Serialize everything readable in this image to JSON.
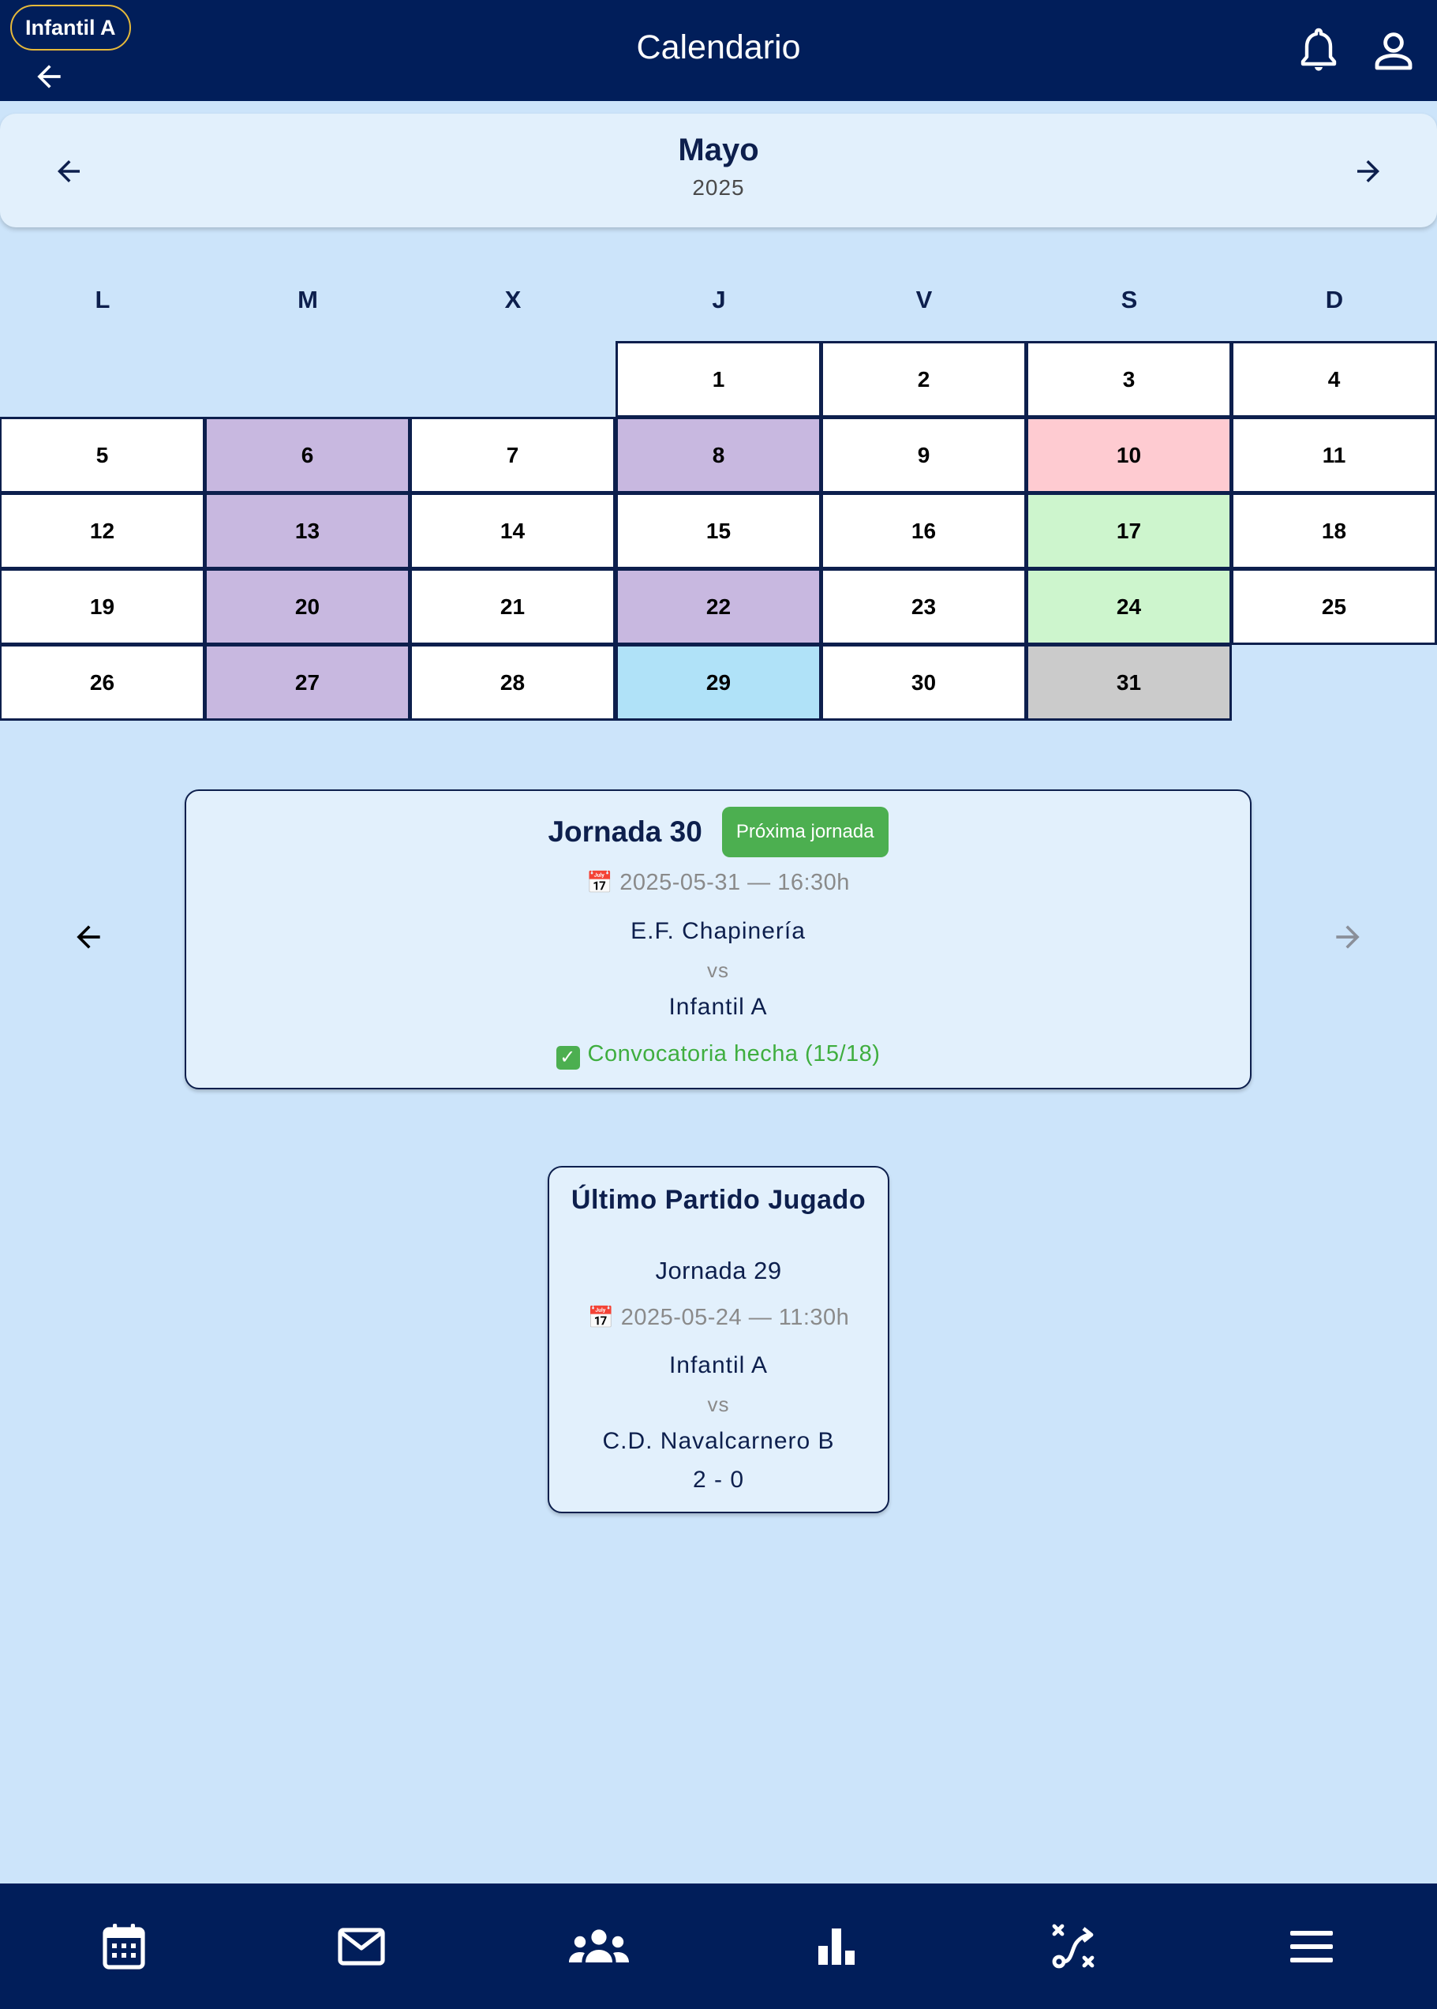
{
  "header": {
    "team_chip": "Infantil A",
    "title": "Calendario"
  },
  "month": {
    "name": "Mayo",
    "year": "2025"
  },
  "weekdays": [
    "L",
    "M",
    "X",
    "J",
    "V",
    "S",
    "D"
  ],
  "days": [
    {
      "day": "1",
      "status": "normal"
    },
    {
      "day": "2",
      "status": "normal"
    },
    {
      "day": "3",
      "status": "normal"
    },
    {
      "day": "4",
      "status": "normal"
    },
    {
      "day": "5",
      "status": "normal"
    },
    {
      "day": "6",
      "status": "training"
    },
    {
      "day": "7",
      "status": "normal"
    },
    {
      "day": "8",
      "status": "training"
    },
    {
      "day": "9",
      "status": "normal"
    },
    {
      "day": "10",
      "status": "match-lost"
    },
    {
      "day": "11",
      "status": "normal"
    },
    {
      "day": "12",
      "status": "normal"
    },
    {
      "day": "13",
      "status": "training"
    },
    {
      "day": "14",
      "status": "normal"
    },
    {
      "day": "15",
      "status": "normal"
    },
    {
      "day": "16",
      "status": "normal"
    },
    {
      "day": "17",
      "status": "match-won"
    },
    {
      "day": "18",
      "status": "normal"
    },
    {
      "day": "19",
      "status": "normal"
    },
    {
      "day": "20",
      "status": "training"
    },
    {
      "day": "21",
      "status": "normal"
    },
    {
      "day": "22",
      "status": "training"
    },
    {
      "day": "23",
      "status": "normal"
    },
    {
      "day": "24",
      "status": "match-won"
    },
    {
      "day": "25",
      "status": "normal"
    },
    {
      "day": "26",
      "status": "normal"
    },
    {
      "day": "27",
      "status": "training"
    },
    {
      "day": "28",
      "status": "normal"
    },
    {
      "day": "29",
      "status": "today"
    },
    {
      "day": "30",
      "status": "normal"
    },
    {
      "day": "31",
      "status": "next-match"
    }
  ],
  "status_colors": {
    "normal": "#ffffff",
    "training": "#c8b8e0",
    "match-lost": "#fecbd1",
    "match-won": "#cdf5cd",
    "today": "#b0e2f8",
    "next-match": "#cbcbcb"
  },
  "next_match": {
    "title": "Jornada 30",
    "badge": "Próxima jornada",
    "date_icon": "📅",
    "datetime": "2025-05-31 — 16:30h",
    "home": "E.F. Chapinería",
    "vs": "vs",
    "away": "Infantil A",
    "call_icon": "✓",
    "call_status": "Convocatoria hecha (15/18)"
  },
  "last_match": {
    "title": "Último Partido Jugado",
    "jornada": "Jornada 29",
    "date_icon": "📅",
    "datetime": "2025-05-24 — 11:30h",
    "home": "Infantil A",
    "vs": "vs",
    "away": "C.D. Navalcarnero B",
    "score": "2 - 0"
  },
  "bottom_nav": [
    {
      "icon": "calendar-icon"
    },
    {
      "icon": "mail-icon"
    },
    {
      "icon": "team-icon"
    },
    {
      "icon": "bar-chart-icon"
    },
    {
      "icon": "tactics-icon"
    },
    {
      "icon": "menu-icon"
    }
  ],
  "colors": {
    "app_bar": "#011e5a",
    "background": "#cce4fa",
    "accent_badge": "#4caf50",
    "chip_border": "#e6b93a"
  }
}
